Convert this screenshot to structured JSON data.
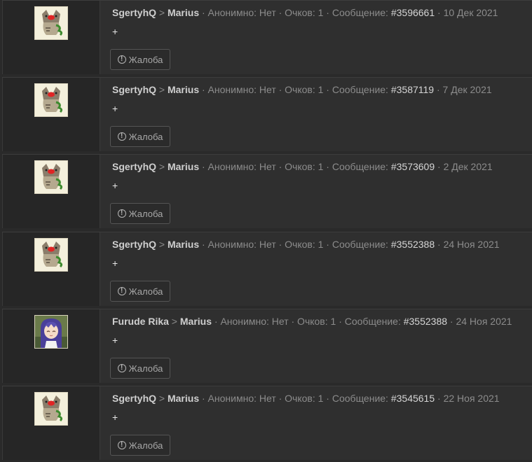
{
  "posts": [
    {
      "author": "SgertyhQ",
      "arrow": ">",
      "recipient": "Marius",
      "meta_prefix": "· Анонимно: Нет · Очков: 1 · Сообщение:",
      "message_id": "#3596661",
      "date": "· 10 Дек 2021",
      "text": "+",
      "report_label": "Жалоба",
      "avatar": "cat"
    },
    {
      "author": "SgertyhQ",
      "arrow": ">",
      "recipient": "Marius",
      "meta_prefix": "· Анонимно: Нет · Очков: 1 · Сообщение:",
      "message_id": "#3587119",
      "date": "· 7 Дек 2021",
      "text": "+",
      "report_label": "Жалоба",
      "avatar": "cat"
    },
    {
      "author": "SgertyhQ",
      "arrow": ">",
      "recipient": "Marius",
      "meta_prefix": "· Анонимно: Нет · Очков: 1 · Сообщение:",
      "message_id": "#3573609",
      "date": "· 2 Дек 2021",
      "text": "+",
      "report_label": "Жалоба",
      "avatar": "cat"
    },
    {
      "author": "SgertyhQ",
      "arrow": ">",
      "recipient": "Marius",
      "meta_prefix": "· Анонимно: Нет · Очков: 1 · Сообщение:",
      "message_id": "#3552388",
      "date": "· 24 Ноя 2021",
      "text": "+",
      "report_label": "Жалоба",
      "avatar": "cat"
    },
    {
      "author": "Furude Rika",
      "arrow": ">",
      "recipient": "Marius",
      "meta_prefix": "· Анонимно: Нет · Очков: 1 · Сообщение:",
      "message_id": "#3552388",
      "date": "· 24 Ноя 2021",
      "text": "+",
      "report_label": "Жалоба",
      "avatar": "anime-girl"
    },
    {
      "author": "SgertyhQ",
      "arrow": ">",
      "recipient": "Marius",
      "meta_prefix": "· Анонимно: Нет · Очков: 1 · Сообщение:",
      "message_id": "#3545615",
      "date": "· 22 Ноя 2021",
      "text": "+",
      "report_label": "Жалоба",
      "avatar": "cat"
    }
  ],
  "report_icon": "exclamation-circle-icon"
}
